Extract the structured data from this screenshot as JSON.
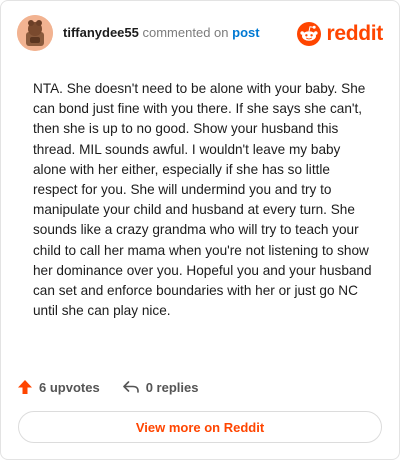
{
  "header": {
    "author": "tiffanydee55",
    "action": "commented on",
    "post_link": "post",
    "brand": "reddit"
  },
  "comment": {
    "text": "NTA. She doesn't need to be alone with your baby. She can bond just fine with you there. If she says she can't, then she is up to no good. Show your husband this thread. MIL sounds awful. I wouldn't leave my baby alone with her either, especially if she has so little respect for you. She will undermind you and try to manipulate your child and husband at every turn. She sounds like a crazy grandma who will try to teach your child to call her mama when you're not listening to show her dominance over you. Hopeful you and your husband can set and enforce boundaries with her or just go NC until she can play nice."
  },
  "meta": {
    "upvotes": "6 upvotes",
    "replies": "0 replies"
  },
  "footer": {
    "view_more": "View more on Reddit"
  },
  "colors": {
    "brand": "#ff4500",
    "link": "#0079d3",
    "text": "#1c1c1c",
    "muted": "#7c7c7c"
  },
  "icons": [
    "avatar",
    "reddit-logo-icon",
    "upvote-arrow-icon",
    "reply-arrow-icon"
  ]
}
